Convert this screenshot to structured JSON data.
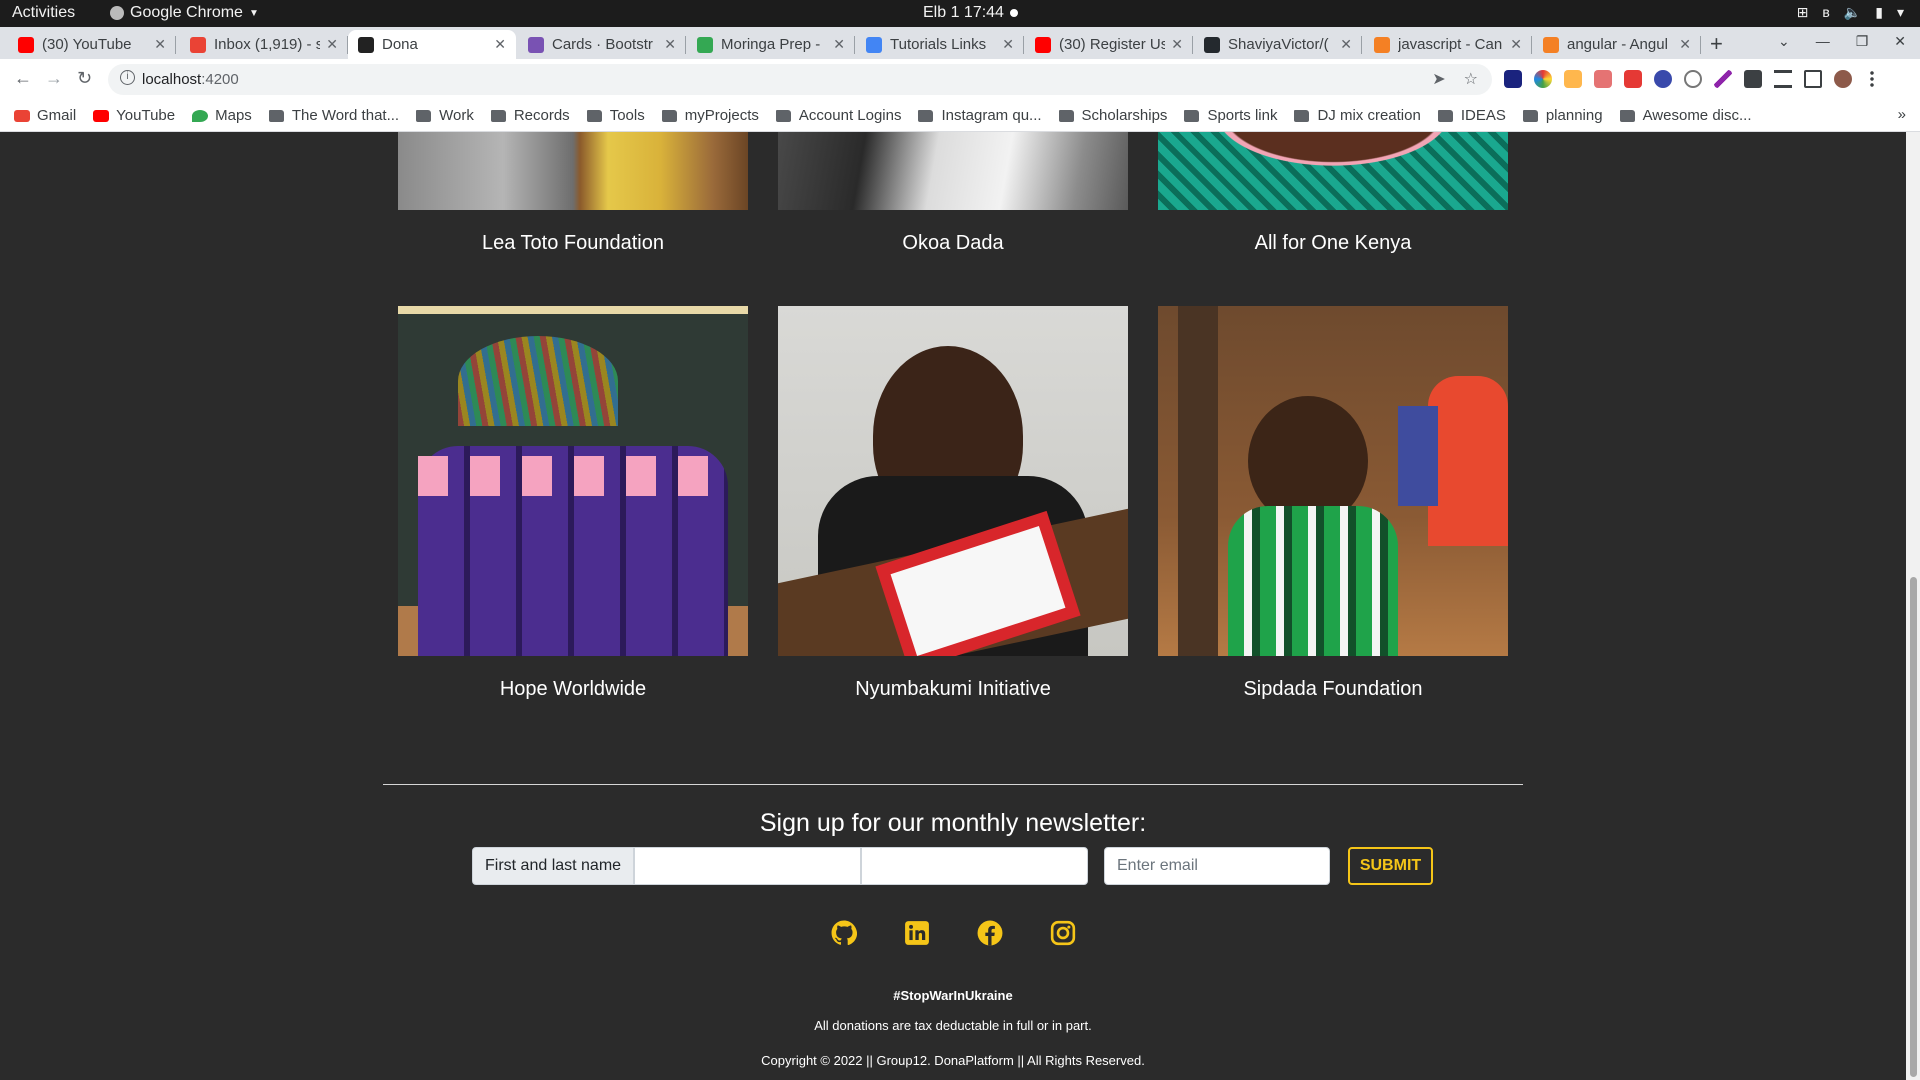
{
  "os_bar": {
    "activities": "Activities",
    "app_name": "Google Chrome",
    "clock": "Elb 1  17:44"
  },
  "tabs": [
    {
      "label": "(30) YouTube",
      "favicon": "youtube-icon",
      "color": "#ff0000"
    },
    {
      "label": "Inbox (1,919) - s",
      "favicon": "gmail-icon",
      "color": "#ea4335"
    },
    {
      "label": "Dona",
      "favicon": "angular-icon",
      "color": "#222222",
      "active": true
    },
    {
      "label": "Cards · Bootstr",
      "favicon": "bootstrap-icon",
      "color": "#7952b3"
    },
    {
      "label": "Moringa Prep -",
      "favicon": "drive-icon",
      "color": "#34a853"
    },
    {
      "label": "Tutorials Links",
      "favicon": "docs-icon",
      "color": "#4285f4"
    },
    {
      "label": "(30) Register Us",
      "favicon": "youtube-icon",
      "color": "#ff0000"
    },
    {
      "label": "ShaviyaVictor/(",
      "favicon": "github-icon",
      "color": "#24292e"
    },
    {
      "label": "javascript - Can",
      "favicon": "stackoverflow-icon",
      "color": "#f48024"
    },
    {
      "label": "angular - Angul",
      "favicon": "stackoverflow-icon",
      "color": "#f48024"
    }
  ],
  "address_bar": {
    "host": "localhost",
    "port": ":4200"
  },
  "bookmarks": [
    {
      "label": "Gmail",
      "icon": "gmail-icon"
    },
    {
      "label": "YouTube",
      "icon": "youtube-icon"
    },
    {
      "label": "Maps",
      "icon": "maps-icon"
    },
    {
      "label": "The Word that...",
      "icon": "folder-icon"
    },
    {
      "label": "Work",
      "icon": "folder-icon"
    },
    {
      "label": "Records",
      "icon": "folder-icon"
    },
    {
      "label": "Tools",
      "icon": "folder-icon"
    },
    {
      "label": "myProjects",
      "icon": "folder-icon"
    },
    {
      "label": "Account Logins",
      "icon": "folder-icon"
    },
    {
      "label": "Instagram qu...",
      "icon": "folder-icon"
    },
    {
      "label": "Scholarships",
      "icon": "folder-icon"
    },
    {
      "label": "Sports link",
      "icon": "folder-icon"
    },
    {
      "label": "DJ mix creation",
      "icon": "folder-icon"
    },
    {
      "label": "IDEAS",
      "icon": "folder-icon"
    },
    {
      "label": "planning",
      "icon": "folder-icon"
    },
    {
      "label": "Awesome disc...",
      "icon": "folder-icon"
    }
  ],
  "organizations": [
    {
      "name": "Lea Toto Foundation"
    },
    {
      "name": "Okoa Dada"
    },
    {
      "name": "All for One Kenya"
    },
    {
      "name": "Hope Worldwide"
    },
    {
      "name": "Nyumbakumi Initiative"
    },
    {
      "name": "Sipdada Foundation"
    }
  ],
  "newsletter": {
    "title": "Sign up for our monthly newsletter:",
    "name_label": "First and last name",
    "email_placeholder": "Enter email",
    "submit_label": "SUBMIT"
  },
  "social": [
    "github-icon",
    "linkedin-icon",
    "facebook-icon",
    "instagram-icon"
  ],
  "footer": {
    "hashtag": "#StopWarInUkraine",
    "tax_note": "All donations are tax deductable in full or in part.",
    "copyright": "Copyright © 2022 || Group12. DonaPlatform || All Rights Reserved."
  },
  "colors": {
    "page_bg": "#2b2b2b",
    "accent": "#f5c518"
  }
}
